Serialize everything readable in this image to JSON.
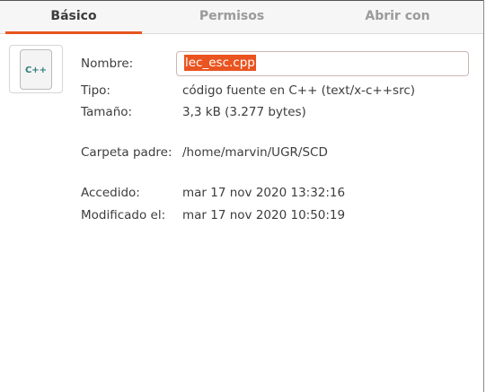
{
  "tabs": [
    {
      "label": "Básico",
      "active": true
    },
    {
      "label": "Permisos"
    },
    {
      "label": "Abrir con"
    }
  ],
  "icon": {
    "name": "cpp-file-icon",
    "text": "C++"
  },
  "fields": {
    "name": {
      "label": "Nombre:",
      "value": "lec_esc.cpp"
    },
    "type": {
      "label": "Tipo:",
      "value": "código fuente en C++ (text/x-c++src)"
    },
    "size": {
      "label": "Tamaño:",
      "value": "3,3 kB (3.277 bytes)"
    },
    "parent": {
      "label": "Carpeta padre:",
      "value": "/home/marvin/UGR/SCD"
    },
    "accessed": {
      "label": "Accedido:",
      "value": "mar 17 nov 2020 13:32:16"
    },
    "modified": {
      "label": "Modificado el:",
      "value": "mar 17 nov 2020 10:50:19"
    }
  },
  "colors": {
    "accent": "#e95420"
  }
}
